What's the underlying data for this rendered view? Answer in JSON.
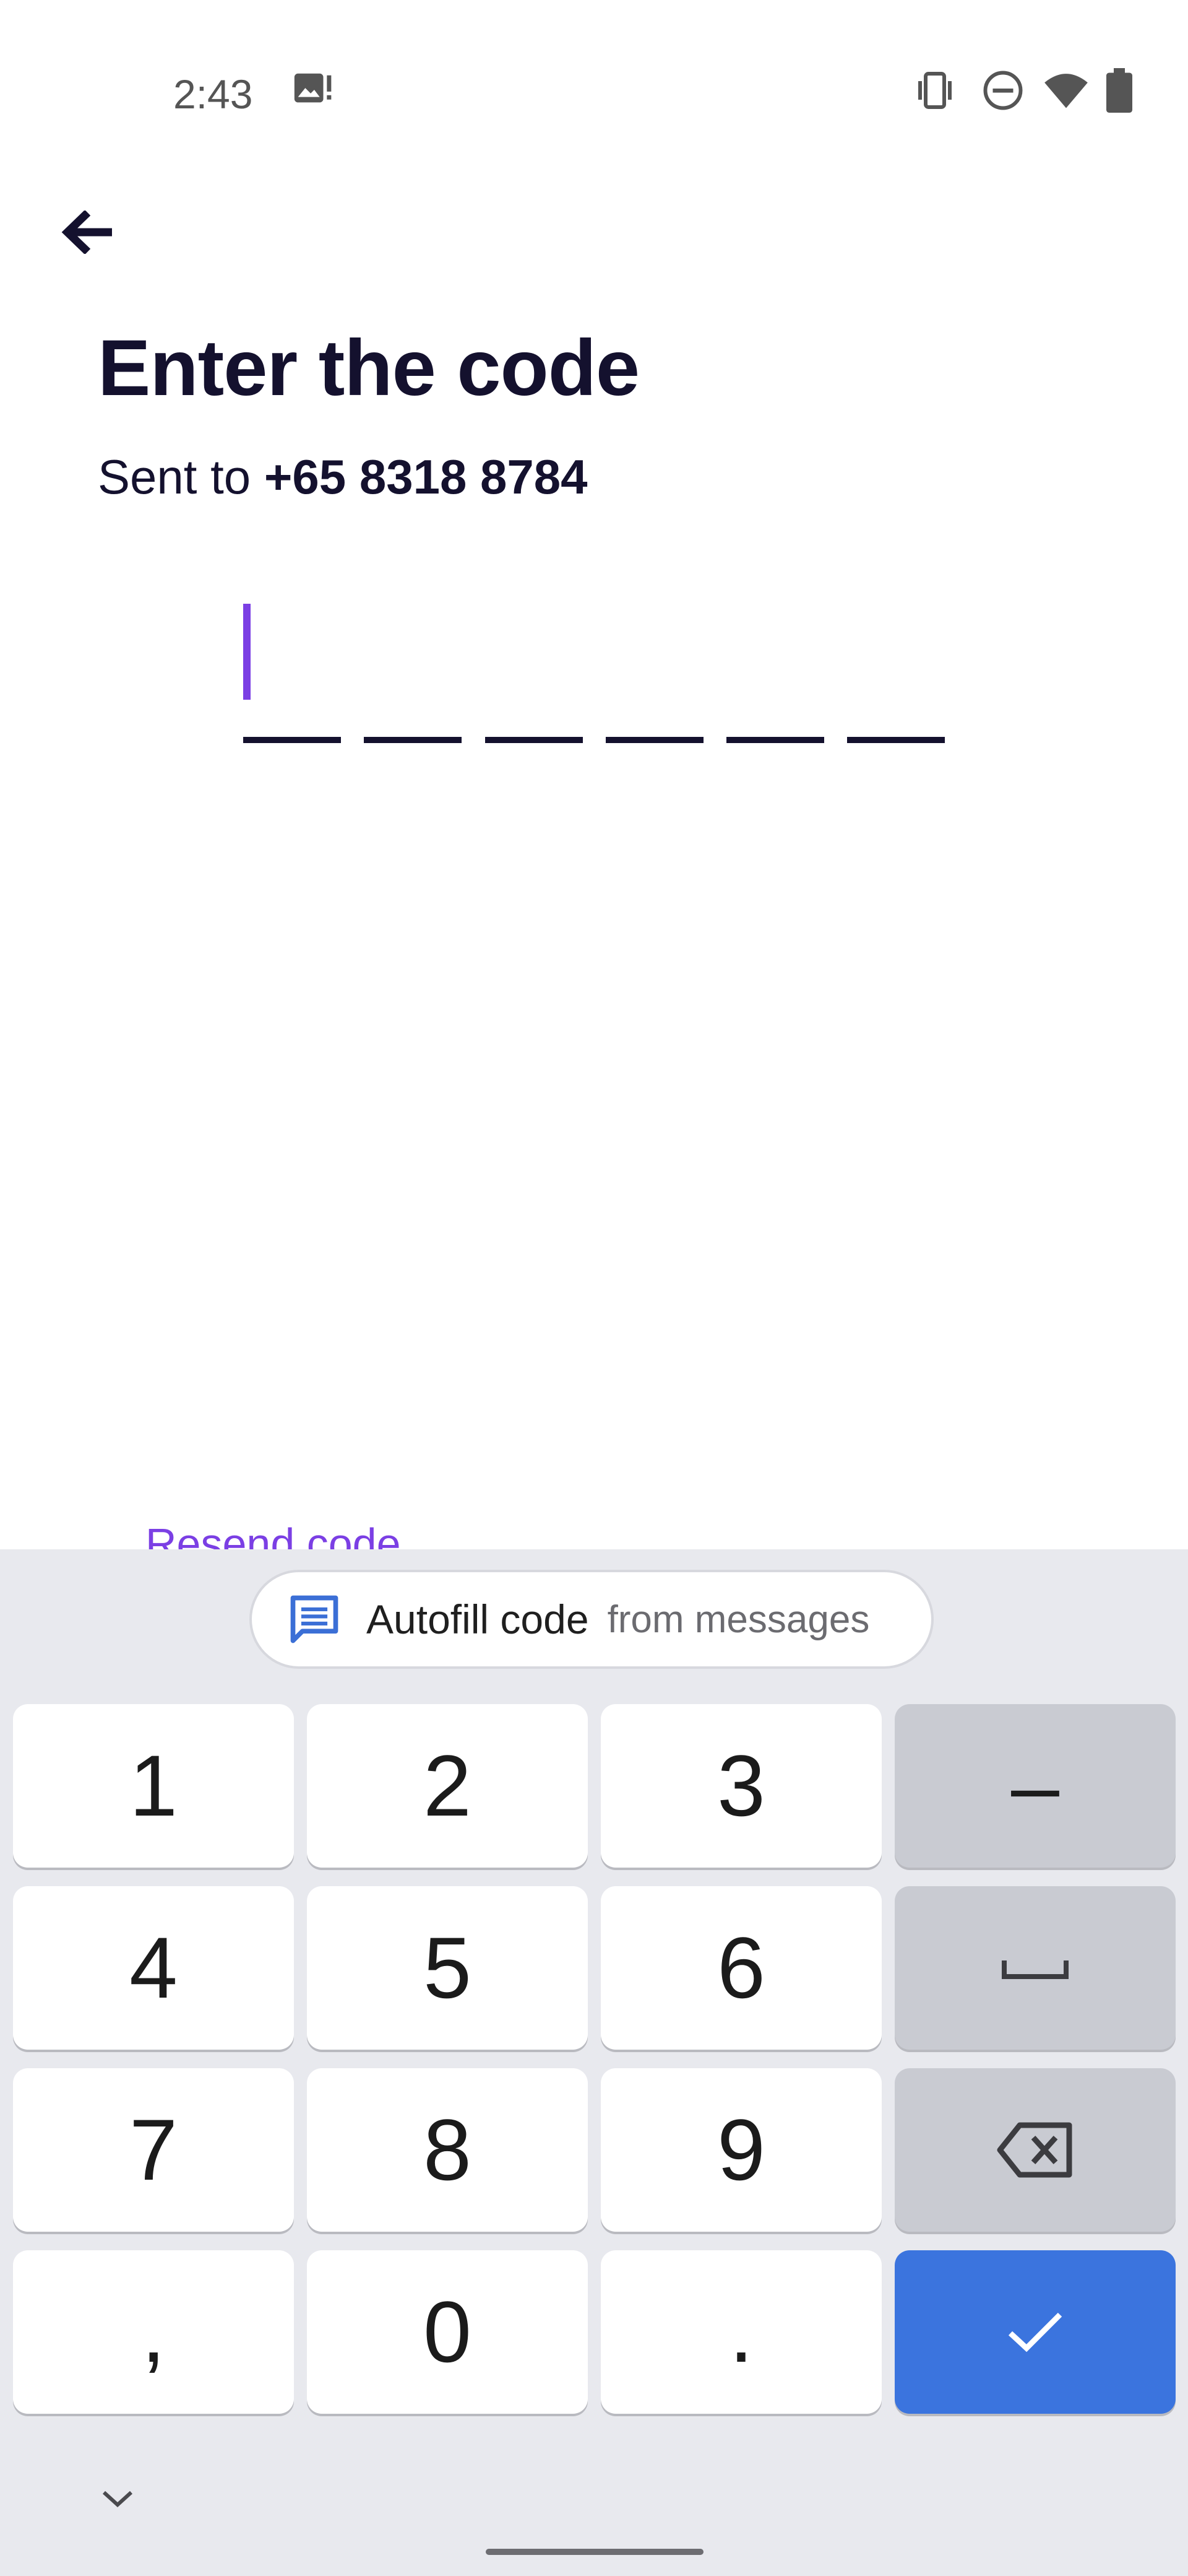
{
  "status_bar": {
    "time": "2:43",
    "icons": [
      "gallery-notification-icon",
      "vibrate-icon",
      "do-not-disturb-icon",
      "wifi-icon",
      "battery-icon"
    ]
  },
  "header": {
    "back_icon": "arrow-left-icon",
    "title": "Enter the code",
    "sent_prefix": "Sent to ",
    "phone": "+65 8318 8784"
  },
  "code_input": {
    "digits": [
      "",
      "",
      "",
      "",
      "",
      ""
    ],
    "accent_color": "#7b3fe4"
  },
  "resend_label": "Resend code",
  "keyboard": {
    "autofill": {
      "icon": "message-icon",
      "main": "Autofill code",
      "sub": "from messages"
    },
    "keys": [
      {
        "label": "1"
      },
      {
        "label": "2"
      },
      {
        "label": "3"
      },
      {
        "label": "–",
        "type": "fn"
      },
      {
        "label": "4"
      },
      {
        "label": "5"
      },
      {
        "label": "6"
      },
      {
        "label": "",
        "icon": "space-icon",
        "type": "fn"
      },
      {
        "label": "7"
      },
      {
        "label": "8"
      },
      {
        "label": "9"
      },
      {
        "label": "",
        "icon": "backspace-icon",
        "type": "fn"
      },
      {
        "label": ","
      },
      {
        "label": "0"
      },
      {
        "label": "."
      },
      {
        "label": "",
        "icon": "checkmark-icon",
        "type": "enter"
      }
    ],
    "enter_color": "#3b74de",
    "collapse_icon": "chevron-down-icon"
  }
}
